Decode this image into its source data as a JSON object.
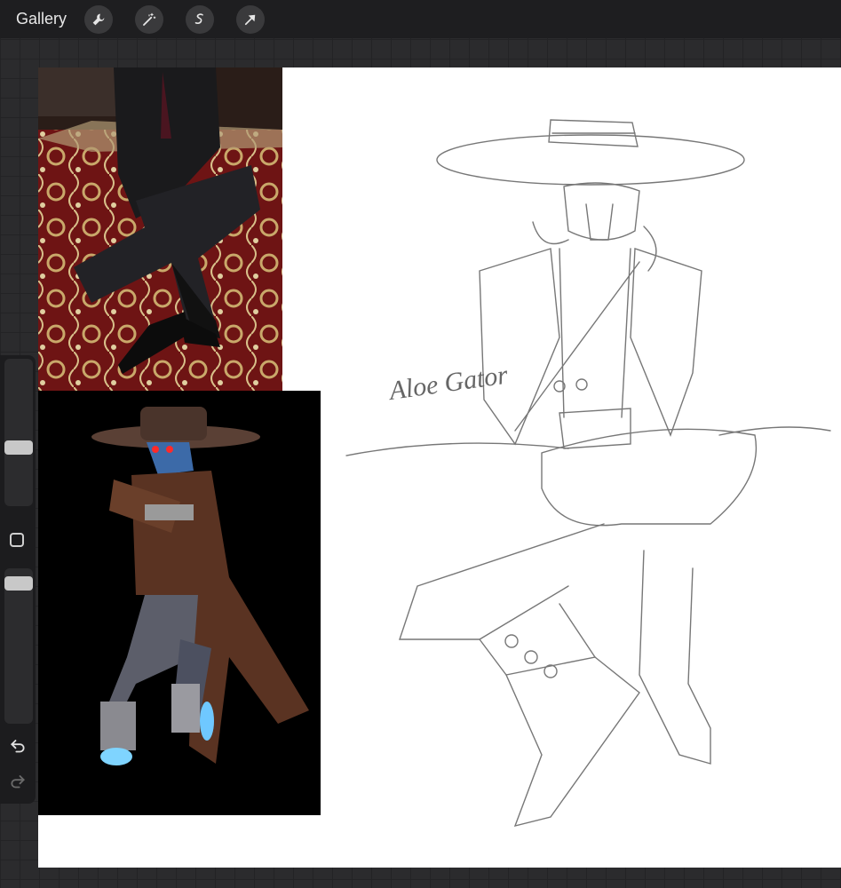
{
  "topbar": {
    "gallery_label": "Gallery",
    "tools": [
      {
        "name": "wrench-icon"
      },
      {
        "name": "magic-wand-icon"
      },
      {
        "name": "selection-icon"
      },
      {
        "name": "transform-arrow-icon"
      }
    ]
  },
  "sketch": {
    "signature_text": "Aloe Gator"
  },
  "sidebar": {
    "brush_size_level": 0.55,
    "opacity_level": 0.1,
    "icons": [
      "modify-square-icon",
      "undo-icon",
      "redo-icon"
    ]
  },
  "colors": {
    "topbar": "#1e1e20",
    "canvas": "#ffffff",
    "workspace": "#2b2b2d"
  }
}
